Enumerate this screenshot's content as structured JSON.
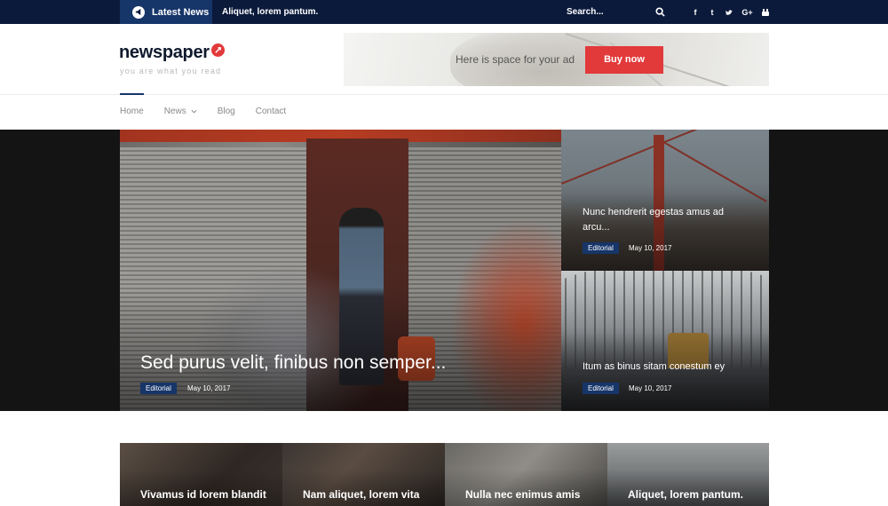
{
  "topbar": {
    "latest_label": "Latest News",
    "ticker": "Aliquet, lorem pantum.",
    "search_label": "Search...",
    "socials": [
      "facebook-icon",
      "tumblr-icon",
      "twitter-icon",
      "google-plus-icon",
      "youtube-icon"
    ]
  },
  "header": {
    "logo_text": "newspaper",
    "tagline": "you are what you read",
    "ad_text": "Here is space for your ad",
    "ad_button": "Buy now"
  },
  "nav": {
    "items": [
      {
        "label": "Home",
        "active": true
      },
      {
        "label": "News",
        "dropdown": true
      },
      {
        "label": "Blog"
      },
      {
        "label": "Contact"
      }
    ]
  },
  "hero": {
    "main": {
      "title": "Sed purus velit, finibus non semper...",
      "category": "Editorial",
      "date": "May 10, 2017"
    },
    "side": [
      {
        "title_line1": "Nunc hendrerit egestas amus ad",
        "title_line2": "arcu...",
        "category": "Editorial",
        "date": "May 10, 2017"
      },
      {
        "title_line1": "Itum as binus sitam conestum ey",
        "title_line2": "",
        "category": "Editorial",
        "date": "May 10, 2017"
      }
    ]
  },
  "cards": [
    {
      "title": "Vivamus id lorem blandit"
    },
    {
      "title": "Nam aliquet, lorem vita"
    },
    {
      "title": "Nulla nec enimus amis"
    },
    {
      "title": "Aliquet, lorem pantum."
    }
  ],
  "colors": {
    "navy": "#0b1a3b",
    "accent_blue": "#163569",
    "accent_red": "#e2393a"
  }
}
